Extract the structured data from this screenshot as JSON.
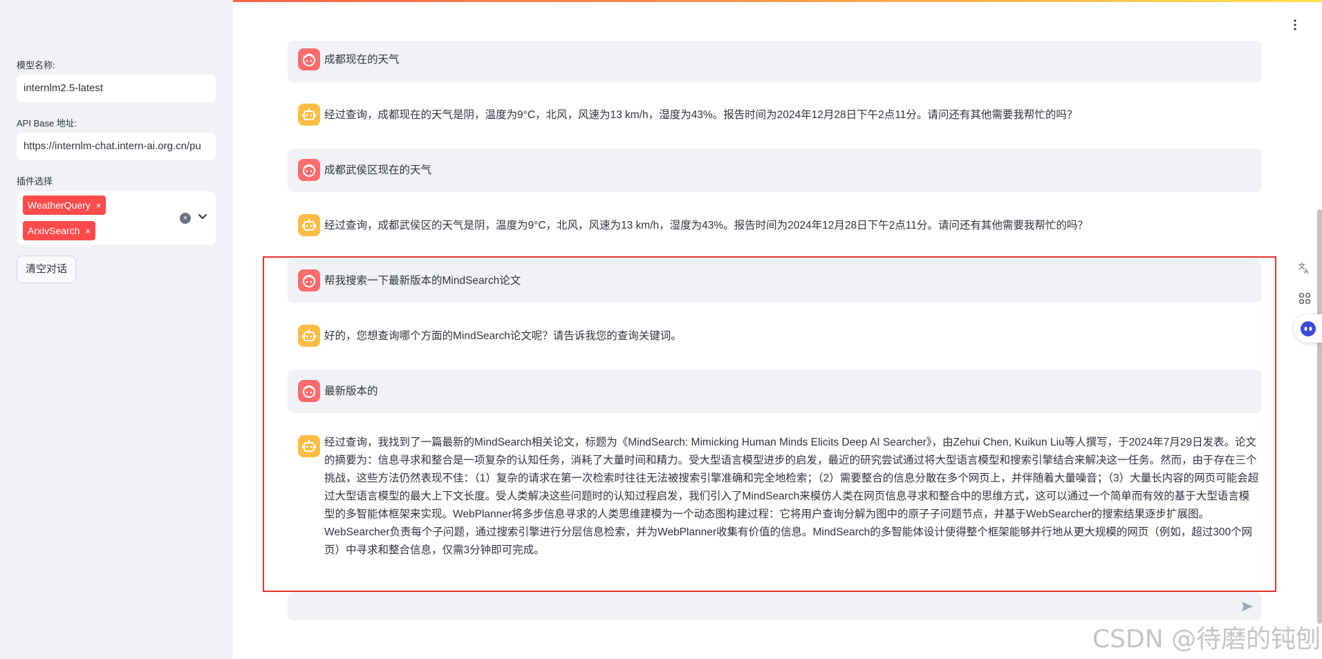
{
  "sidebar": {
    "model_label": "模型名称:",
    "model_value": "internlm2.5-latest",
    "api_label": "API Base 地址:",
    "api_value": "https://internlm-chat.intern-ai.org.cn/pu",
    "plugin_label": "插件选择",
    "plugins": [
      "WeatherQuery",
      "ArxivSearch"
    ],
    "tag_close": "×",
    "clear_all": "×",
    "clear_button": "清空对话"
  },
  "chat": {
    "messages": [
      {
        "role": "user",
        "text": "成都现在的天气"
      },
      {
        "role": "assistant",
        "text": "经过查询，成都现在的天气是阴，温度为9°C，北风，风速为13 km/h，湿度为43%。报告时间为2024年12月28日下午2点11分。请问还有其他需要我帮忙的吗？"
      },
      {
        "role": "user",
        "text": "成都武侯区现在的天气"
      },
      {
        "role": "assistant",
        "text": "经过查询，成都武侯区的天气是阴，温度为9°C，北风，风速为13 km/h，湿度为43%。报告时间为2024年12月28日下午2点11分。请问还有其他需要我帮忙的吗？"
      },
      {
        "role": "user",
        "text": "帮我搜索一下最新版本的MindSearch论文"
      },
      {
        "role": "assistant",
        "text": "好的，您想查询哪个方面的MindSearch论文呢？请告诉我您的查询关键词。"
      },
      {
        "role": "user",
        "text": "最新版本的"
      },
      {
        "role": "assistant",
        "text": "经过查询，我找到了一篇最新的MindSearch相关论文，标题为《MindSearch: Mimicking Human Minds Elicits Deep AI Searcher》，由Zehui Chen, Kuikun Liu等人撰写，于2024年7月29日发表。论文的摘要为：信息寻求和整合是一项复杂的认知任务，消耗了大量时间和精力。受大型语言模型进步的启发，最近的研究尝试通过将大型语言模型和搜索引擎结合来解决这一任务。然而，由于存在三个挑战，这些方法仍然表现不佳：（1）复杂的请求在第一次检索时往往无法被搜索引擎准确和完全地检索；（2）需要整合的信息分散在多个网页上，并伴随着大量噪音；（3）大量长内容的网页可能会超过大型语言模型的最大上下文长度。受人类解决这些问题时的认知过程启发，我们引入了MindSearch来模仿人类在网页信息寻求和整合中的思维方式，这可以通过一个简单而有效的基于大型语言模型的多智能体框架来实现。WebPlanner将多步信息寻求的人类思维建模为一个动态图构建过程：它将用户查询分解为图中的原子子问题节点，并基于WebSearcher的搜索结果逐步扩展图。WebSearcher负责每个子问题，通过搜索引擎进行分层信息检索，并为WebPlanner收集有价值的信息。MindSearch的多智能体设计使得整个框架能够并行地从更大规模的网页（例如，超过300个网页）中寻求和整合信息，仅需3分钟即可完成。"
      }
    ]
  },
  "watermark": "CSDN @待磨的钝刨"
}
